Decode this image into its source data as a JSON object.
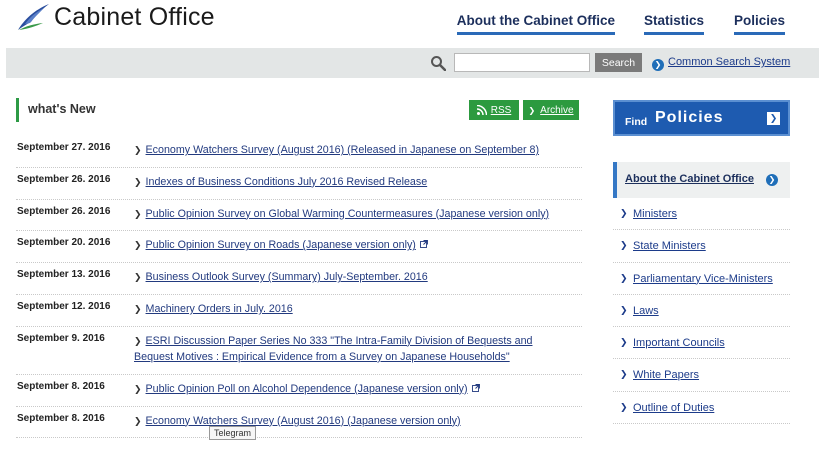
{
  "header": {
    "site_title": "Cabinet Office",
    "nav": [
      "About the Cabinet Office",
      "Statistics",
      "Policies"
    ]
  },
  "search": {
    "placeholder": "",
    "button_label": "Search",
    "common_search_label": "Common Search System"
  },
  "news": {
    "title": "what's New",
    "rss_label": "RSS",
    "archive_label": "Archive",
    "items": [
      {
        "date": "September 27. 2016",
        "text": "Economy Watchers Survey (August 2016) (Released in Japanese on September 8)",
        "external": false
      },
      {
        "date": "September 26. 2016",
        "text": "Indexes of Business Conditions July 2016 Revised Release",
        "external": false
      },
      {
        "date": "September 26. 2016",
        "text": "Public Opinion Survey on Global Warming Countermeasures (Japanese version only)",
        "external": false
      },
      {
        "date": "September 20. 2016",
        "text": "Public Opinion Survey on Roads (Japanese version only)",
        "external": true
      },
      {
        "date": "September 13. 2016",
        "text": "Business Outlook Survey (Summary) July-September. 2016",
        "external": false
      },
      {
        "date": "September 12. 2016",
        "text": "Machinery Orders in July. 2016",
        "external": false
      },
      {
        "date": "September 9. 2016",
        "text": "ESRI Discussion Paper Series No 333 \"The Intra-Family Division of Bequests and Bequest Motives : Empirical Evidence from a Survey on Japanese Households\"",
        "external": false
      },
      {
        "date": "September 8. 2016",
        "text": "Public Opinion Poll on Alcohol Dependence (Japanese version only)",
        "external": true
      },
      {
        "date": "September 8. 2016",
        "text": "Economy Watchers Survey (August 2016) (Japanese version only)",
        "external": false
      }
    ]
  },
  "tooltip": "Telegram",
  "sidebar": {
    "find_small": "Find",
    "find_big": "Policies",
    "section_title": "About the Cabinet Office",
    "items": [
      "Ministers",
      "State Ministers",
      "Parliamentary Vice-Ministers",
      "Laws",
      "Important Councils",
      "White Papers",
      "Outline of Duties"
    ]
  },
  "colors": {
    "brand_navy": "#1c2f5c",
    "accent_blue": "#1e5bb0",
    "accent_green": "#2c9a3f",
    "link_blue": "#223a7f"
  }
}
